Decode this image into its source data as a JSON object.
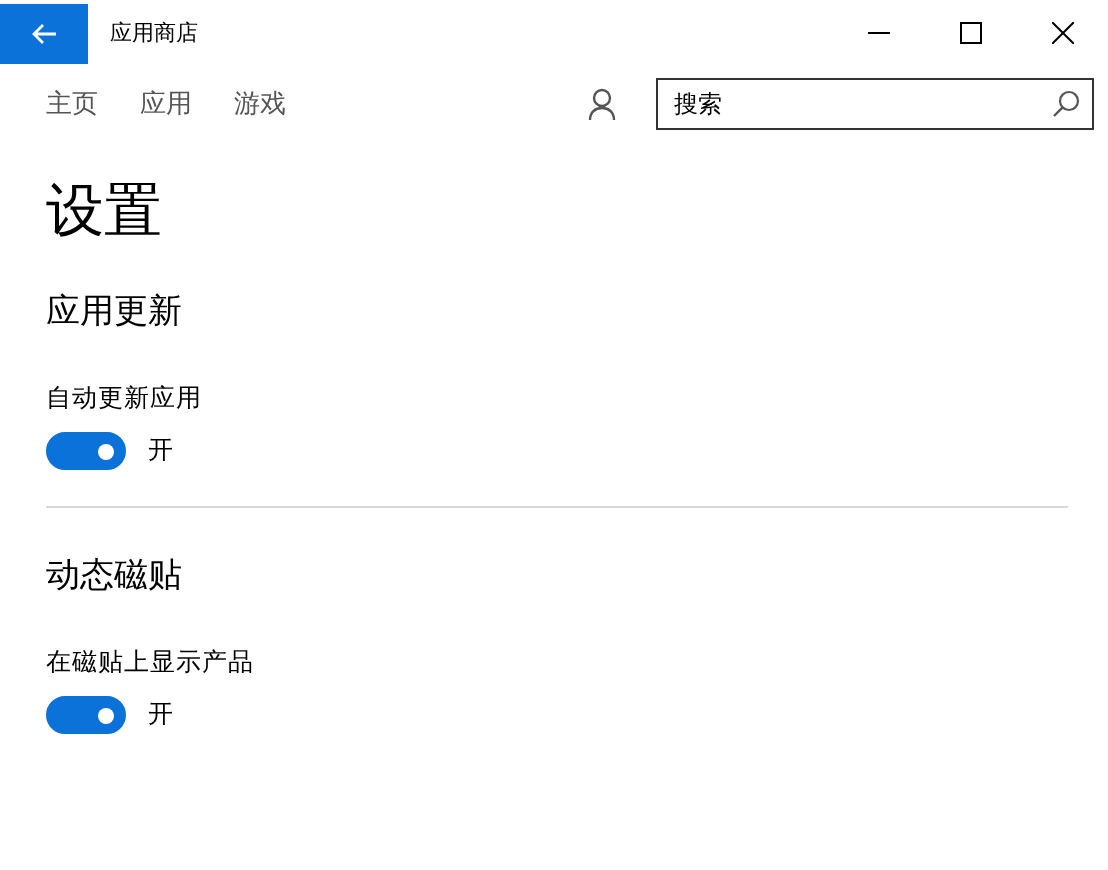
{
  "window": {
    "title": "应用商店"
  },
  "nav": [
    {
      "label": "主页"
    },
    {
      "label": "应用"
    },
    {
      "label": "游戏"
    }
  ],
  "search": {
    "placeholder": "搜索"
  },
  "page_title": "设置",
  "sections": [
    {
      "title": "应用更新",
      "settings": [
        {
          "label": "自动更新应用",
          "on": true,
          "state_text": "开"
        }
      ]
    },
    {
      "title": "动态磁贴",
      "settings": [
        {
          "label": "在磁贴上显示产品",
          "on": true,
          "state_text": "开"
        }
      ]
    }
  ]
}
